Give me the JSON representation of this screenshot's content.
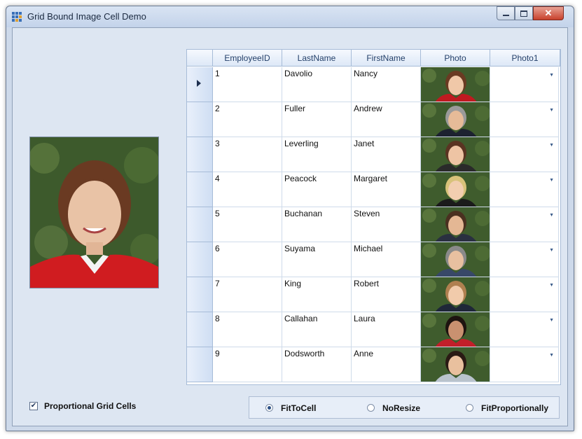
{
  "window": {
    "title": "Grid Bound Image Cell Demo"
  },
  "grid": {
    "columns": [
      "EmployeeID",
      "LastName",
      "FirstName",
      "Photo",
      "Photo1"
    ],
    "rows": [
      {
        "id": "1",
        "last": "Davolio",
        "first": "Nancy"
      },
      {
        "id": "2",
        "last": "Fuller",
        "first": "Andrew"
      },
      {
        "id": "3",
        "last": "Leverling",
        "first": "Janet"
      },
      {
        "id": "4",
        "last": "Peacock",
        "first": "Margaret"
      },
      {
        "id": "5",
        "last": "Buchanan",
        "first": "Steven"
      },
      {
        "id": "6",
        "last": "Suyama",
        "first": "Michael"
      },
      {
        "id": "7",
        "last": "King",
        "first": "Robert"
      },
      {
        "id": "8",
        "last": "Callahan",
        "first": "Laura"
      },
      {
        "id": "9",
        "last": "Dodsworth",
        "first": "Anne"
      }
    ],
    "selected_row": 0
  },
  "options": {
    "proportional_label": "Proportional Grid Cells",
    "proportional_checked": true,
    "radios": [
      {
        "label": "FitToCell",
        "checked": true
      },
      {
        "label": "NoResize",
        "checked": false
      },
      {
        "label": "FitProportionally",
        "checked": false
      }
    ]
  },
  "colors": {
    "accent": "#3a70b8",
    "grid_border": "#a7bcd8",
    "window_bg": "#dde6f2"
  }
}
